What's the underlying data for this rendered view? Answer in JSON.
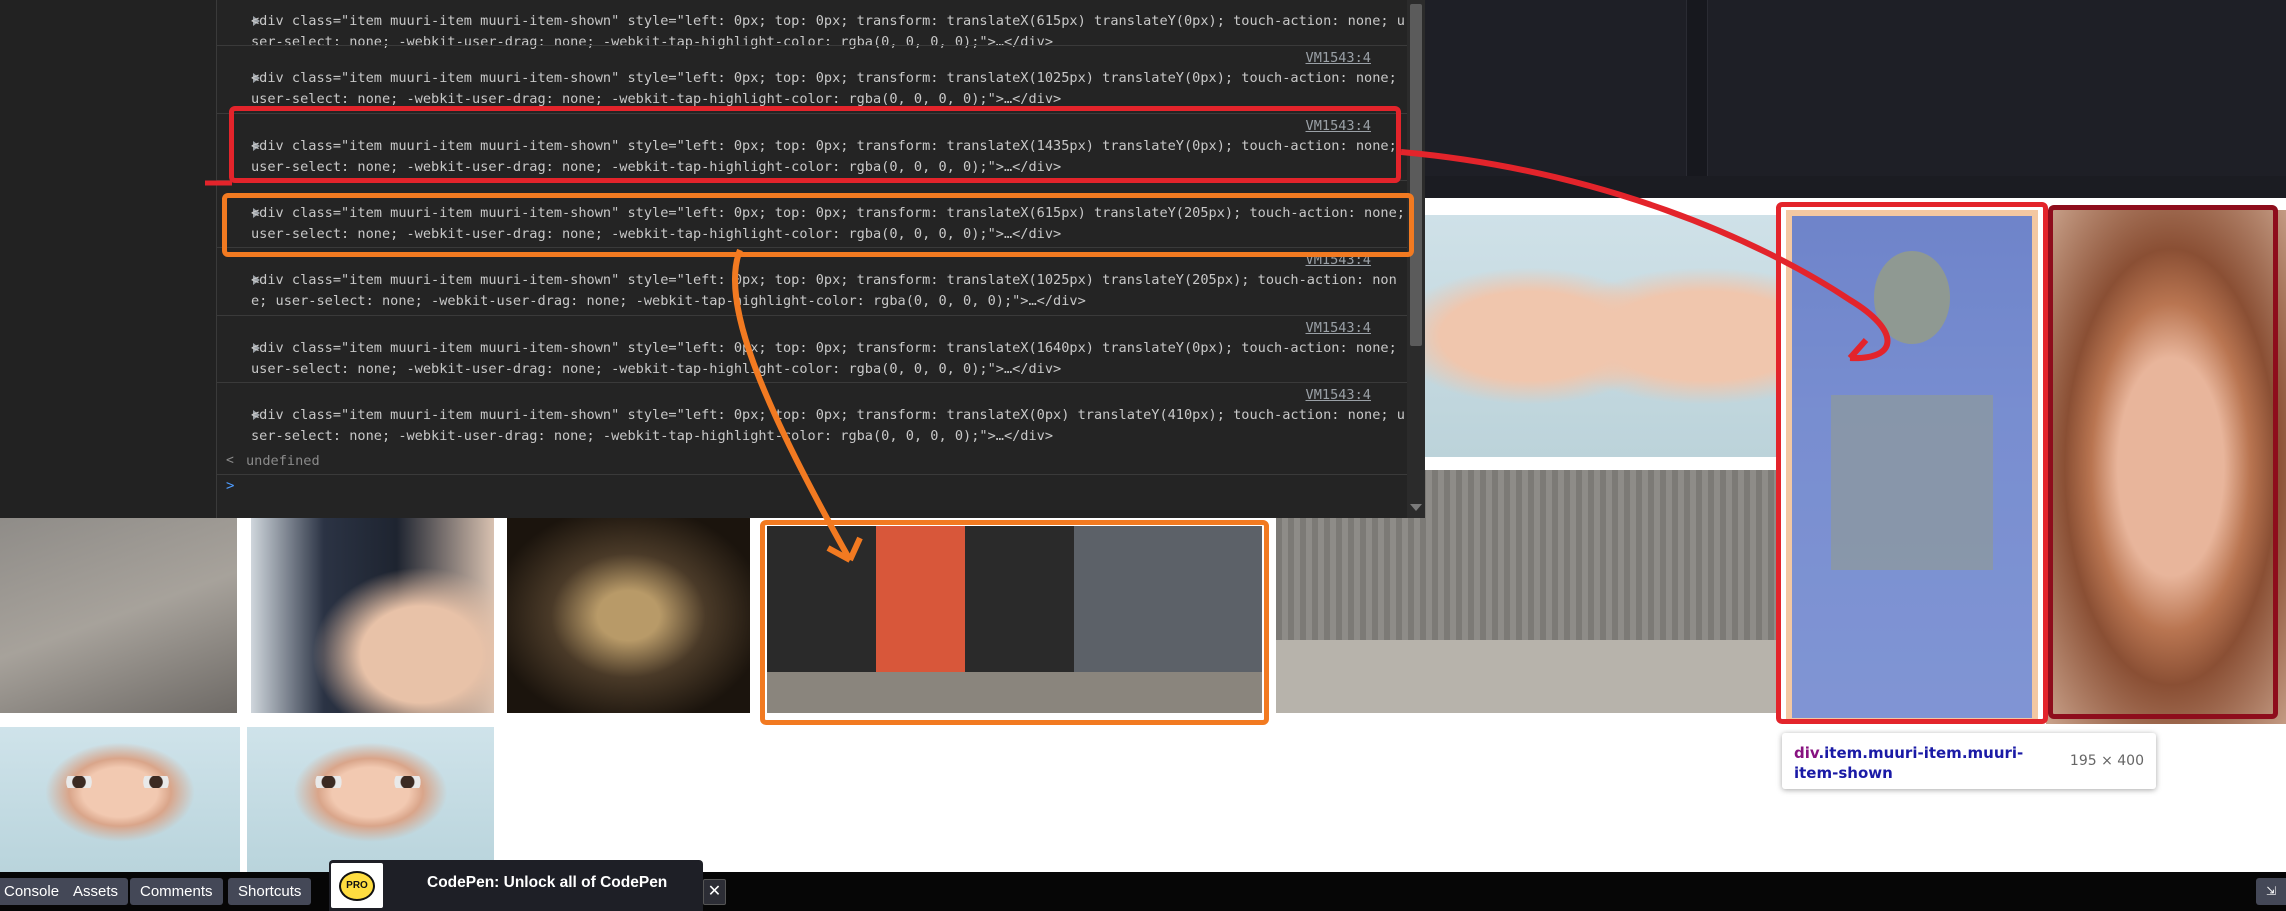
{
  "console": {
    "messages": [
      {
        "source": "",
        "code": "<div class=\"item muuri-item muuri-item-shown\" style=\"left: 0px; top: 0px; transform: translateX(615px) translateY(0px); touch-action: none; user-select: none; -webkit-user-drag: none; -webkit-tap-highlight-color: rgba(0, 0, 0, 0);\">…</div>"
      },
      {
        "source": "VM1543:4",
        "code": "<div class=\"item muuri-item muuri-item-shown\" style=\"left: 0px; top: 0px; transform: translateX(1025px) translateY(0px); touch-action: none; user-select: none; -webkit-user-drag: none; -webkit-tap-highlight-color: rgba(0, 0, 0, 0);\">…</div>"
      },
      {
        "source": "VM1543:4",
        "code": "<div class=\"item muuri-item muuri-item-shown\" style=\"left: 0px; top: 0px; transform: translateX(1435px) translateY(0px); touch-action: none; user-select: none; -webkit-user-drag: none; -webkit-tap-highlight-color: rgba(0, 0, 0, 0);\">…</div>"
      },
      {
        "source": "",
        "code": "<div class=\"item muuri-item muuri-item-shown\" style=\"left: 0px; top: 0px; transform: translateX(615px) translateY(205px); touch-action: none; user-select: none; -webkit-user-drag: none; -webkit-tap-highlight-color: rgba(0, 0, 0, 0);\">…</div>"
      },
      {
        "source": "VM1543:4",
        "code": "<div class=\"item muuri-item muuri-item-shown\" style=\"left: 0px; top: 0px; transform: translateX(1025px) translateY(205px); touch-action: none; user-select: none; -webkit-user-drag: none; -webkit-tap-highlight-color: rgba(0, 0, 0, 0);\">…</div>"
      },
      {
        "source": "VM1543:4",
        "code": "<div class=\"item muuri-item muuri-item-shown\" style=\"left: 0px; top: 0px; transform: translateX(1640px) translateY(0px); touch-action: none; user-select: none; -webkit-user-drag: none; -webkit-tap-highlight-color: rgba(0, 0, 0, 0);\">…</div>"
      },
      {
        "source": "VM1543:4",
        "code": "<div class=\"item muuri-item muuri-item-shown\" style=\"left: 0px; top: 0px; transform: translateX(0px) translateY(410px); touch-action: none; user-select: none; -webkit-user-drag: none; -webkit-tap-highlight-color: rgba(0, 0, 0, 0);\">…</div>"
      }
    ],
    "result": "undefined",
    "prompt": ">",
    "result_arrow": "<"
  },
  "inspector_tooltip": {
    "selector_tag": "div",
    "selector_classes": ".item.muuri-item.muuri-item-shown",
    "dimensions": "195 × 400"
  },
  "bottom_bar": {
    "buttons": [
      "Console",
      "Assets",
      "Comments",
      "Shortcuts"
    ],
    "promo_badge": "PRO",
    "promo_text": "CodePen: Unlock all of CodePen",
    "close_symbol": "✕"
  },
  "colors": {
    "highlight_red": "#e3242b",
    "highlight_orange": "#f27a21",
    "highlight_dark_red": "#8e0d1c"
  },
  "icons": {
    "expand": "triangle-right-icon",
    "close": "close-icon",
    "corner": "collapse-icon"
  }
}
